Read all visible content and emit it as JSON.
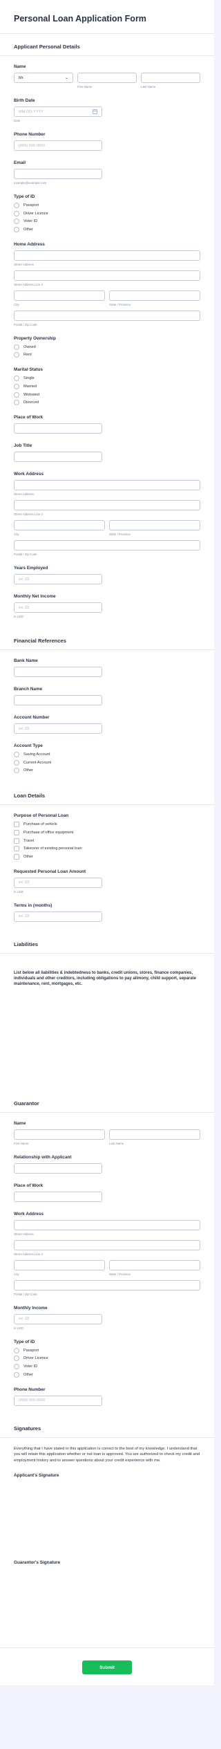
{
  "title": "Personal Loan Application Form",
  "applicant": {
    "section": "Applicant Personal Details",
    "name_label": "Name",
    "prefix_value": "Mr.",
    "first_name_sub": "First Name",
    "last_name_sub": "Last Name",
    "birth_label": "Birth Date",
    "birth_placeholder": "MM-DD-YYYY",
    "birth_sub": "Date",
    "phone_label": "Phone Number",
    "phone_placeholder": "(000) 000-0000",
    "email_label": "Email",
    "email_sub": "example@example.com",
    "id_type_label": "Type of ID",
    "id_types": [
      "Passport",
      "Driver Licence",
      "Voter ID",
      "Other"
    ],
    "home_address_label": "Home Address",
    "street_sub": "Street Address",
    "street2_sub": "Street Address Line 2",
    "city_sub": "City",
    "state_sub": "State / Province",
    "postal_sub": "Postal / Zip Code",
    "property_label": "Property Ownership",
    "property_options": [
      "Owned",
      "Rent"
    ],
    "marital_label": "Marital Status",
    "marital_options": [
      "Single",
      "Married",
      "Widowed",
      "Divorced"
    ],
    "work_place_label": "Place of Work",
    "job_title_label": "Job Title",
    "work_address_label": "Work Address",
    "years_label": "Years Employed",
    "years_placeholder": "ex: 23",
    "income_label": "Monthly Net Income",
    "income_placeholder": "ex: 23",
    "income_sub": "in USD"
  },
  "financial": {
    "section": "Financial References",
    "bank_label": "Bank Name",
    "branch_label": "Branch Name",
    "account_label": "Account Number",
    "account_placeholder": "ex: 23",
    "account_type_label": "Account Type",
    "account_types": [
      "Saving Account",
      "Current Account",
      "Other"
    ]
  },
  "loan": {
    "section": "Loan Details",
    "purpose_label": "Purpose of Personal Loan",
    "purposes": [
      "Purchase of vehicle",
      "Purchase of office equipment",
      "Travel",
      "Takeover of existing personal loan",
      "Other"
    ],
    "amount_label": "Requested Personal Loan Amount",
    "amount_placeholder": "ex: 23",
    "amount_sub": "in USD",
    "terms_label": "Terms in (months)",
    "terms_placeholder": "ex: 23"
  },
  "liabilities": {
    "section": "Liabilities",
    "notice": "List below all liabilities & indebtedness to banks, credit unions, stores, finance companies, individuals and other creditors, including obligations to pay alimony, child support, separate maintenance, rent, mortgages, etc."
  },
  "guarantor": {
    "section": "Guarantor",
    "name_label": "Name",
    "first_name_sub": "First Name",
    "last_name_sub": "Last Name",
    "relationship_label": "Relationship with Applicant",
    "work_place_label": "Place of Work",
    "work_address_label": "Work Address",
    "street_sub": "Street Address",
    "street2_sub": "Street Address Line 2",
    "city_sub": "City",
    "state_sub": "State / Province",
    "postal_sub": "Postal / Zip Code",
    "income_label": "Monthly Income",
    "income_placeholder": "ex: 23",
    "income_sub": "in USD",
    "id_type_label": "Type of ID",
    "id_types": [
      "Passport",
      "Driver Licence",
      "Voter ID",
      "Other"
    ],
    "phone_label": "Phone Number",
    "phone_placeholder": "(000) 000-0000"
  },
  "signatures": {
    "section": "Signatures",
    "statement": "Everything that I have stated in this application is correct to the best of my knowledge. I understand that you will retain this application whether or not loan is approved. You are authorized to check my credit and employment history and to answer questions about your credit experience with me.",
    "applicant_label": "Applicant's Signature",
    "guarantor_label": "Guarantor's Signature"
  },
  "submit_label": "Submit"
}
